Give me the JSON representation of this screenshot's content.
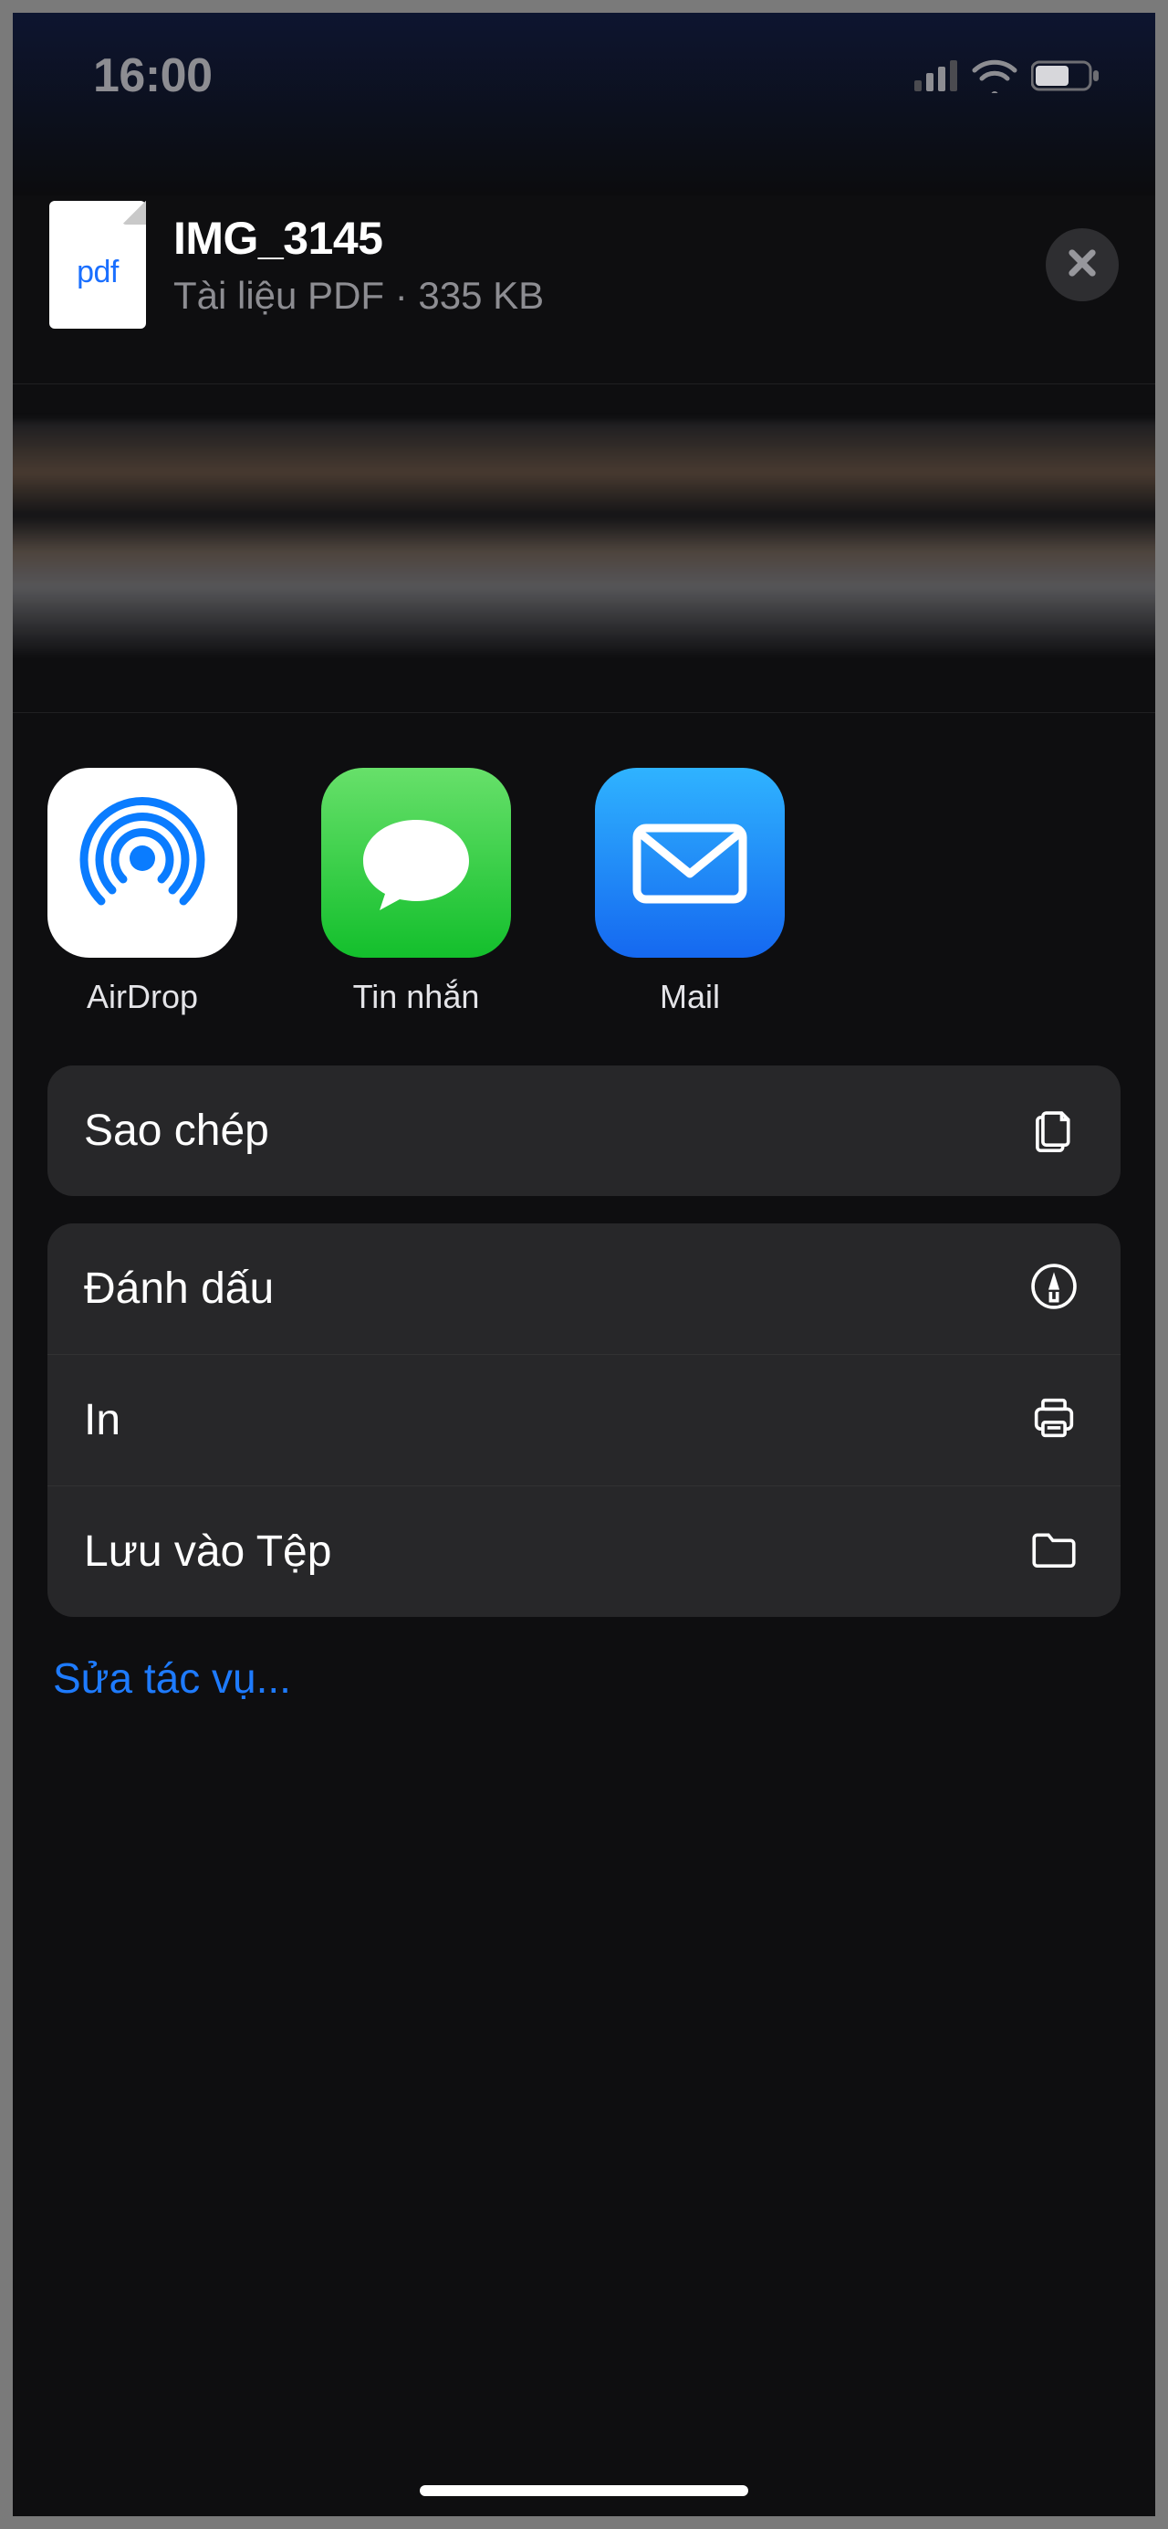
{
  "status": {
    "time": "16:00"
  },
  "file": {
    "icon_label": "pdf",
    "name": "IMG_3145",
    "type": "Tài liệu PDF",
    "separator": " · ",
    "size": "335 KB"
  },
  "share_apps": [
    {
      "id": "airdrop",
      "label": "AirDrop"
    },
    {
      "id": "messages",
      "label": "Tin nhắn"
    },
    {
      "id": "mail",
      "label": "Mail"
    }
  ],
  "actions": {
    "copy": "Sao chép",
    "markup": "Đánh dấu",
    "print": "In",
    "save": "Lưu vào Tệp"
  },
  "edit_actions": "Sửa tác vụ..."
}
